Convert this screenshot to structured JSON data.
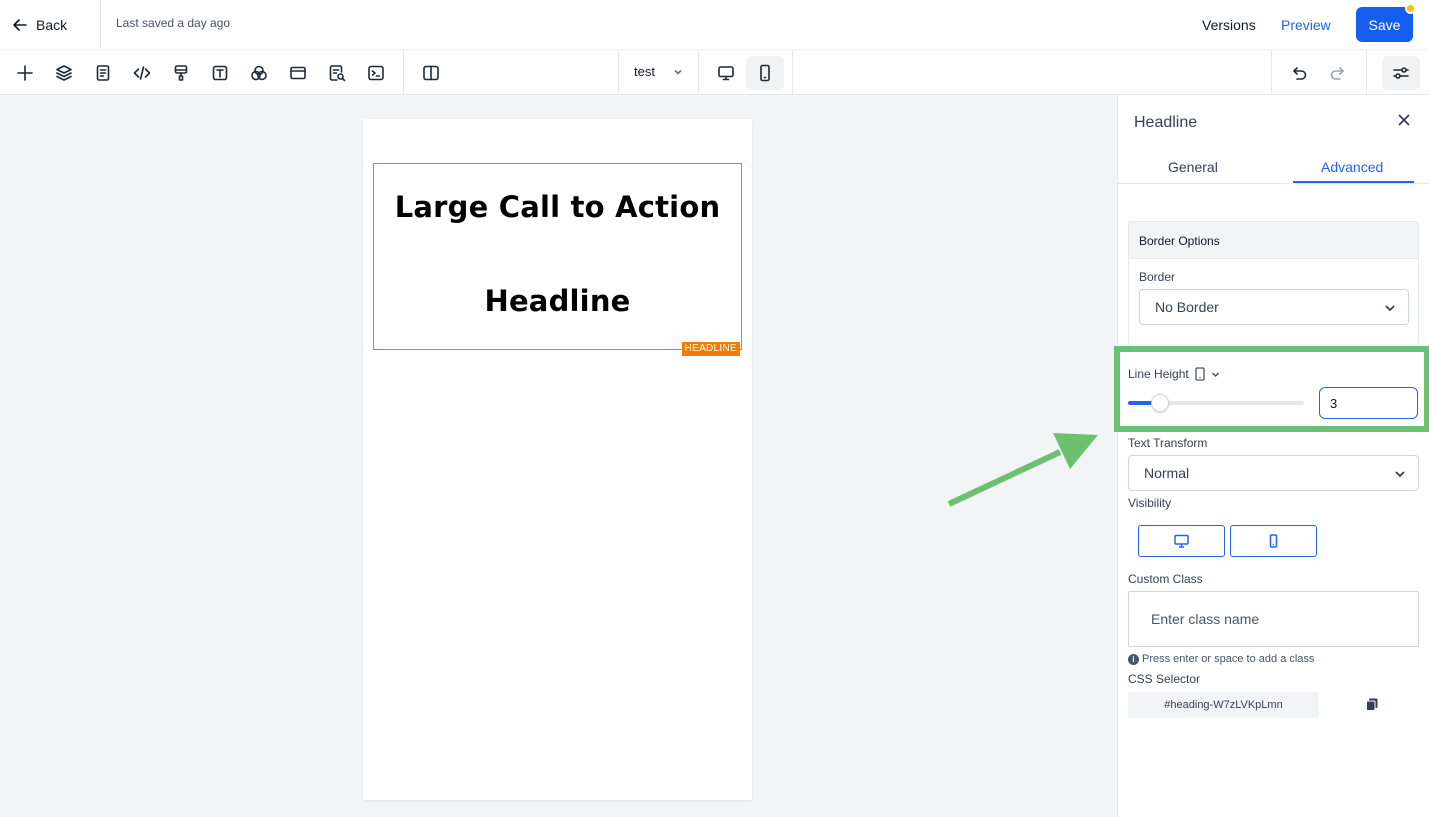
{
  "topbar": {
    "back_label": "Back",
    "saved_text": "Last saved a day ago",
    "versions_label": "Versions",
    "preview_label": "Preview",
    "save_label": "Save"
  },
  "toolbar": {
    "page_select_value": "test",
    "icons": [
      "add-icon",
      "layers-icon",
      "page-icon",
      "code-icon",
      "paint-brush-icon",
      "text-icon",
      "color-circles-icon",
      "section-icon",
      "seo-search-icon",
      "terminal-icon",
      "split-view-icon"
    ],
    "device_icons": [
      "desktop-icon",
      "mobile-icon"
    ],
    "active_device": "mobile",
    "history_icons": [
      "undo-icon",
      "redo-icon"
    ],
    "settings_icon": "settings-sliders-icon"
  },
  "canvas": {
    "headline_line1": "Large Call to Action",
    "headline_line2": "Headline",
    "element_tag": "HEADLINE",
    "selected_color": "#f57c00"
  },
  "panel": {
    "title": "Headline",
    "tabs": [
      {
        "label": "General",
        "active": false
      },
      {
        "label": "Advanced",
        "active": true
      }
    ],
    "border_options": {
      "header": "Border Options",
      "border_label": "Border",
      "border_value": "No Border"
    },
    "line_height": {
      "label": "Line Height",
      "value": "3",
      "slider_fraction": 0.18
    },
    "text_transform": {
      "label": "Text Transform",
      "value": "Normal"
    },
    "visibility": {
      "label": "Visibility"
    },
    "custom_class": {
      "label": "Custom Class",
      "placeholder": "Enter class name",
      "hint": "Press enter or space to add a class"
    },
    "css_selector": {
      "label": "CSS Selector",
      "value": "#heading-W7zLVKpLmn"
    }
  },
  "colors": {
    "accent": "#155eef",
    "link": "#2563eb",
    "highlight": "#6cc070",
    "selection": "#f57c00"
  }
}
